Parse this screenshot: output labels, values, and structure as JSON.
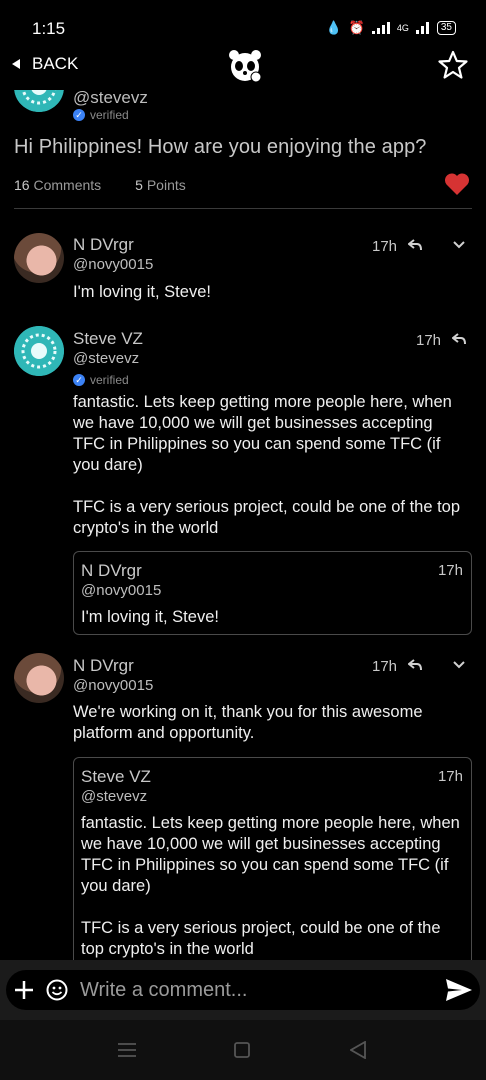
{
  "status_bar": {
    "time": "1:15",
    "network": "4G",
    "battery": "35"
  },
  "top_bar": {
    "back_label": "BACK"
  },
  "post": {
    "author_handle": "@stevevz",
    "verified_label": "verified",
    "title": "Hi Philippines! How are you enjoying the app?",
    "comments_count": "16",
    "comments_label": "Comments",
    "points_count": "5",
    "points_label": "Points"
  },
  "comments": [
    {
      "name": "N DVrgr",
      "handle": "@novy0015",
      "time": "17h",
      "text": "I'm loving it, Steve!"
    },
    {
      "name": "Steve VZ",
      "handle": "@stevevz",
      "verified_label": "verified",
      "time": "17h",
      "text": "fantastic. Lets keep getting more people here, when we have 10,000 we will get businesses accepting TFC in Philippines so you can spend some TFC (if you dare)\n\nTFC is a very serious project, could be one of the top crypto's in the world",
      "quote": {
        "name": "N DVrgr",
        "handle": "@novy0015",
        "time": "17h",
        "text": "I'm loving it, Steve!"
      }
    },
    {
      "name": "N DVrgr",
      "handle": "@novy0015",
      "time": "17h",
      "text": "We're working on it, thank you for this awesome platform and opportunity.",
      "quote": {
        "name": "Steve VZ",
        "handle": "@stevevz",
        "time": "17h",
        "text": "fantastic. Lets keep getting more people here, when we have 10,000 we will get businesses accepting TFC in Philippines so you can spend some TFC (if you dare)\n\nTFC is a very serious project, could be one of the top crypto's in the world"
      }
    }
  ],
  "composer": {
    "placeholder": "Write a comment..."
  },
  "colors": {
    "accent_heart": "#d63333",
    "avatar_teal": "#2fb7b7",
    "verified_blue": "#3b82f6"
  }
}
